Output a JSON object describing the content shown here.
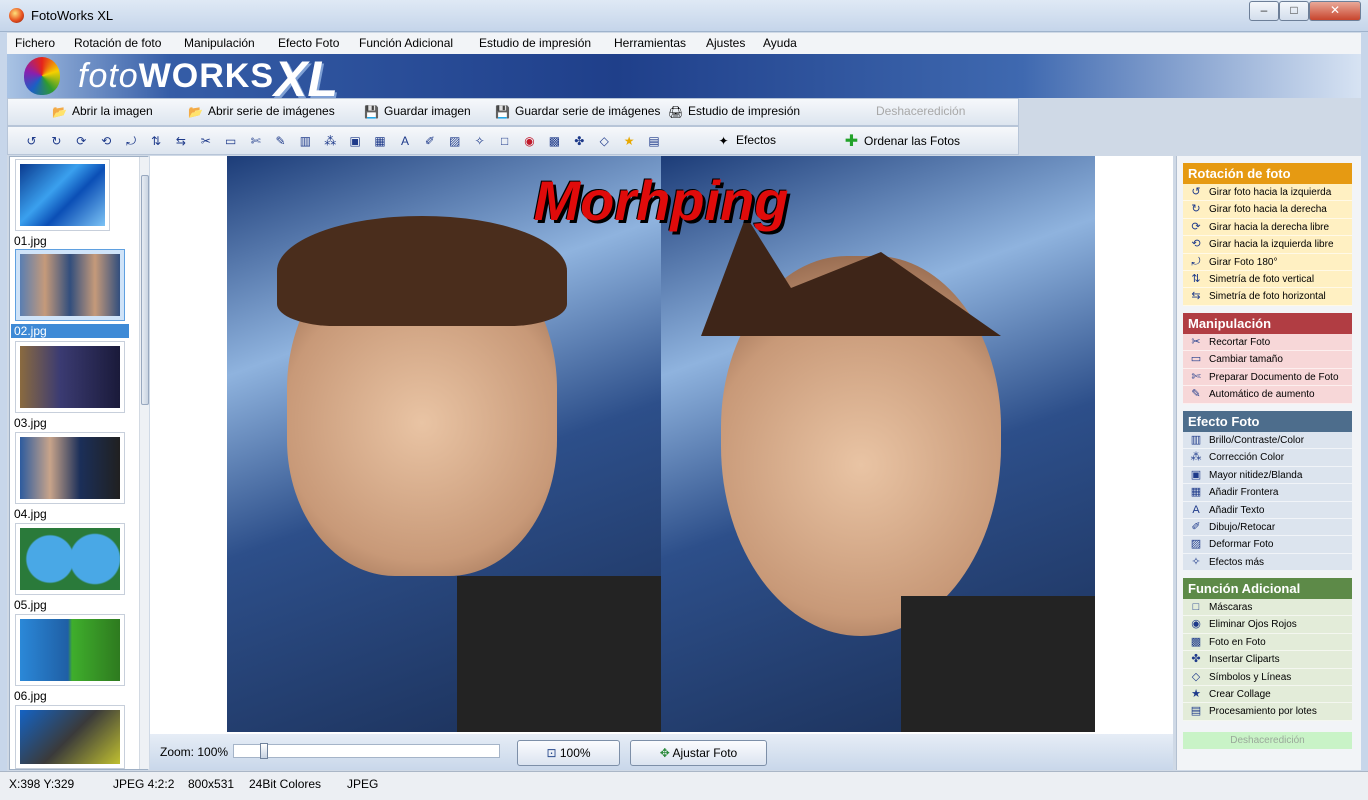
{
  "window": {
    "title": "FotoWorks XL",
    "minimize": "–",
    "maximize": "□",
    "close": "✕"
  },
  "menu": [
    "Fichero",
    "Rotación de foto",
    "Manipulación",
    "Efecto Foto",
    "Función Adicional",
    "Estudio de impresión",
    "Herramientas",
    "Ajustes",
    "Ayuda"
  ],
  "banner": {
    "logo_foto": "foto",
    "logo_works": "WORKS",
    "logo_xl": "XL"
  },
  "toolbar1": {
    "open_image": "Abrir la imagen",
    "open_series": "Abrir serie de imágenes",
    "save_image": "Guardar imagen",
    "save_series": "Guardar serie de imágenes",
    "print_studio": "Estudio de impresión",
    "undo": "Deshaceredición"
  },
  "toolbar2": {
    "effects": "Efectos",
    "sort_photos": "Ordenar las Fotos",
    "icons": [
      "rotate-left-icon",
      "rotate-right-icon",
      "rotate-free-right-icon",
      "rotate-free-left-icon",
      "rotate-180-icon",
      "mirror-vertical-icon",
      "mirror-horizontal-icon",
      "crop-icon",
      "resize-icon",
      "prepare-document-icon",
      "auto-enhance-icon",
      "brightness-icon",
      "color-correction-icon",
      "sharpen-icon",
      "frame-icon",
      "text-icon",
      "retouch-icon",
      "deform-icon",
      "more-effects-icon",
      "mask-icon",
      "red-eye-icon",
      "photo-in-photo-icon",
      "clipart-icon",
      "symbols-icon",
      "collage-icon",
      "batch-icon"
    ]
  },
  "thumbnails": [
    {
      "label": "01.jpg",
      "selected": false
    },
    {
      "label": "02.jpg",
      "selected": true
    },
    {
      "label": "03.jpg",
      "selected": false
    },
    {
      "label": "04.jpg",
      "selected": false
    },
    {
      "label": "05.jpg",
      "selected": false
    },
    {
      "label": "06.jpg",
      "selected": false
    },
    {
      "label": "",
      "selected": false
    }
  ],
  "viewer": {
    "photo_title": "Morhping"
  },
  "zoom": {
    "label": "Zoom: 100%",
    "level": 0.1,
    "btn_100": "100%",
    "btn_fit": "Ajustar Foto"
  },
  "right_panel": {
    "rotation": {
      "title": "Rotación de foto",
      "color": "#e69a12",
      "bg": "#fff0c2",
      "items": [
        "Girar foto hacia la izquierda",
        "Girar foto hacia la derecha",
        "Girar hacia la derecha libre",
        "Girar hacia la izquierda libre",
        "Girar Foto 180°",
        "Simetría de foto vertical",
        "Simetría de foto horizontal"
      ]
    },
    "manipulation": {
      "title": "Manipulación",
      "color": "#b13d43",
      "bg": "#f7d7d8",
      "items": [
        "Recortar Foto",
        "Cambiar tamaño",
        "Preparar Documento de Foto",
        "Automático de aumento"
      ]
    },
    "effect": {
      "title": "Efecto Foto",
      "color": "#4d6d8c",
      "bg": "#dce4ee",
      "items": [
        "Brillo/Contraste/Color",
        "Corrección Color",
        "Mayor nitidez/Blanda",
        "Añadir Frontera",
        "Añadir Texto",
        "Dibujo/Retocar",
        "Deformar Foto",
        "Efectos más"
      ]
    },
    "extra": {
      "title": "Función Adicional",
      "color": "#5d8a48",
      "bg": "#e3ecd9",
      "items": [
        "Máscaras",
        "Eliminar Ojos Rojos",
        "Foto en Foto",
        "Insertar Cliparts",
        "Símbolos y Líneas",
        "Crear Collage",
        "Procesamiento por lotes"
      ]
    },
    "undo": "Deshaceredición"
  },
  "status": {
    "coords": "X:398 Y:329",
    "format": "JPEG  4:2:2",
    "size": "800x531",
    "colors": "24Bit Colores",
    "type": "JPEG"
  }
}
